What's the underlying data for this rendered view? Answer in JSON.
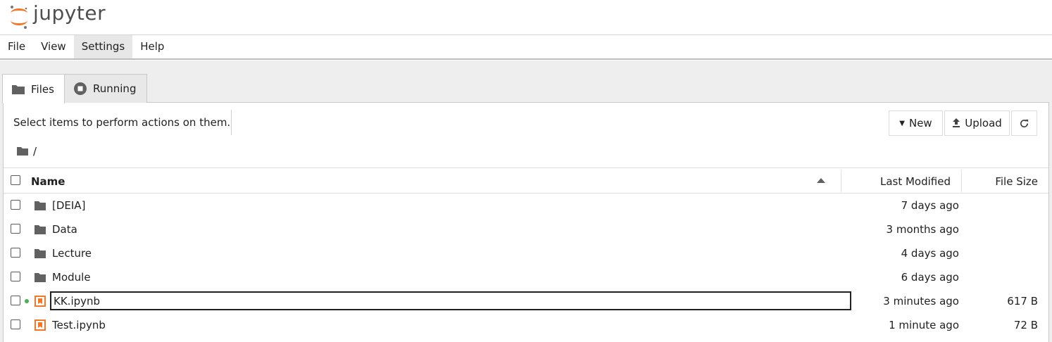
{
  "header": {
    "logo_text": "jupyter"
  },
  "menu": {
    "items": [
      {
        "label": "File"
      },
      {
        "label": "View"
      },
      {
        "label": "Settings"
      },
      {
        "label": "Help"
      }
    ]
  },
  "tabs": [
    {
      "label": "Files",
      "icon": "folder-icon"
    },
    {
      "label": "Running",
      "icon": "stop-circle-icon"
    }
  ],
  "toolbar": {
    "hint": "Select items to perform actions on them.",
    "new_label": "New",
    "upload_label": "Upload"
  },
  "breadcrumb": {
    "path": "/"
  },
  "list": {
    "columns": {
      "name": "Name",
      "modified": "Last Modified",
      "size": "File Size"
    },
    "rows": [
      {
        "name": "[DEIA]",
        "type": "folder",
        "modified": "7 days ago",
        "size": ""
      },
      {
        "name": "Data",
        "type": "folder",
        "modified": "3 months ago",
        "size": ""
      },
      {
        "name": "Lecture",
        "type": "folder",
        "modified": "4 days ago",
        "size": ""
      },
      {
        "name": "Module",
        "type": "folder",
        "modified": "6 days ago",
        "size": ""
      },
      {
        "name": "KK.ipynb",
        "type": "notebook",
        "modified": "3 minutes ago",
        "size": "617 B",
        "running": true
      },
      {
        "name": "Test.ipynb",
        "type": "notebook",
        "modified": "1 minute ago",
        "size": "72 B"
      }
    ]
  },
  "colors": {
    "jupyter_orange": "#f37726",
    "running_green": "#4caf50",
    "folder_gray": "#616161"
  }
}
